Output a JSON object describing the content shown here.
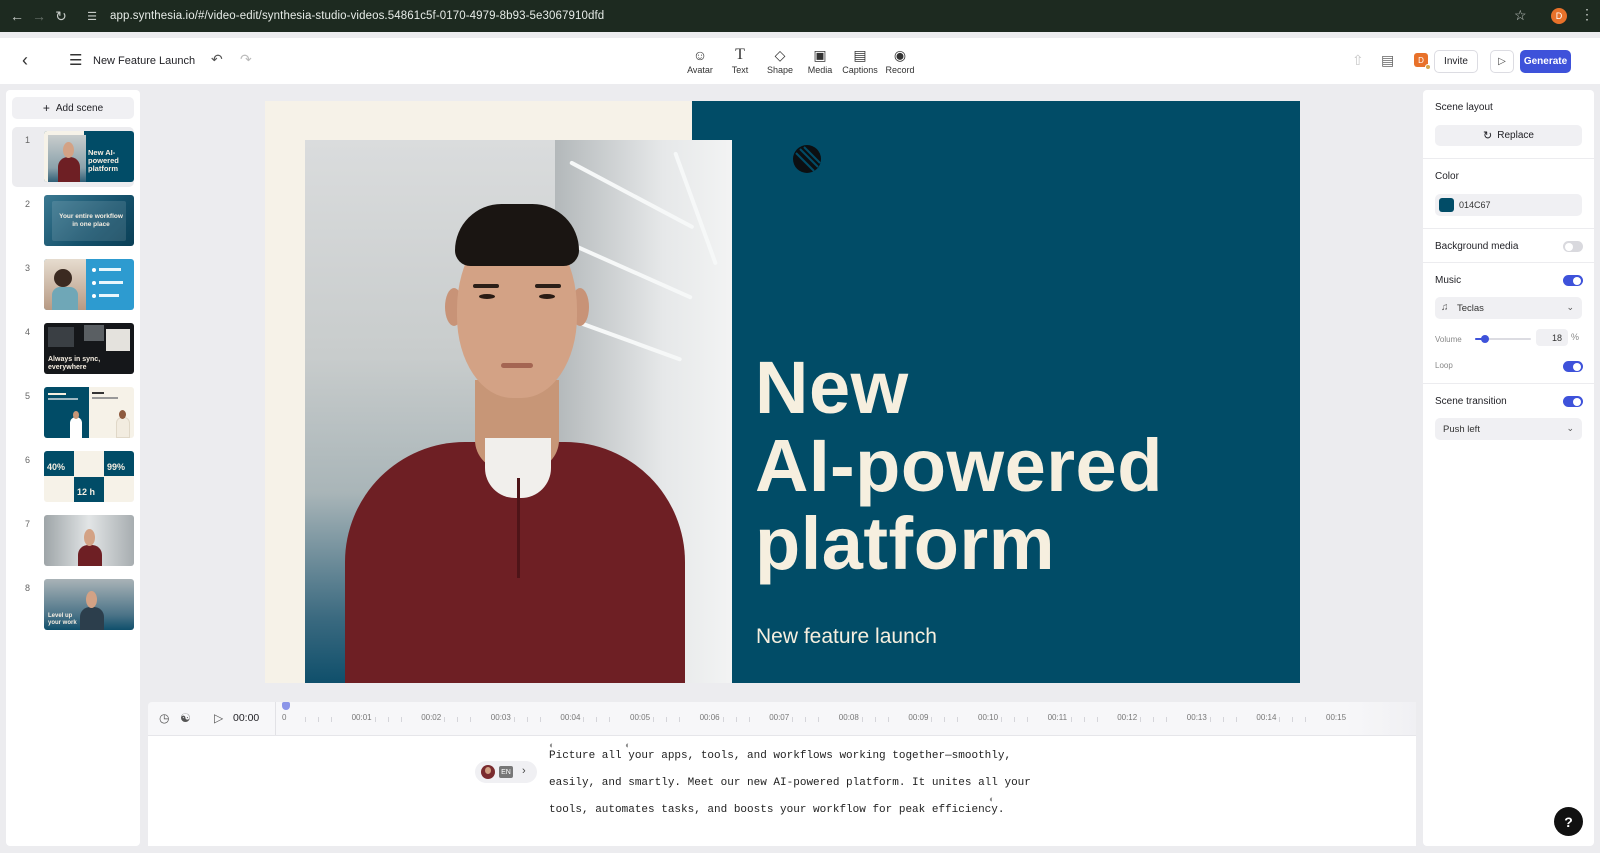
{
  "browser": {
    "url": "app.synthesia.io/#/video-edit/synthesia-studio-videos.54861c5f-0170-4979-8b93-5e3067910dfd",
    "profile_initial": "D"
  },
  "header": {
    "title": "New Feature Launch",
    "tools": [
      {
        "label": "Avatar",
        "icon": "avatar-icon"
      },
      {
        "label": "Text",
        "icon": "text-icon"
      },
      {
        "label": "Shape",
        "icon": "shape-icon"
      },
      {
        "label": "Media",
        "icon": "media-icon"
      },
      {
        "label": "Captions",
        "icon": "captions-icon"
      },
      {
        "label": "Record",
        "icon": "record-icon"
      }
    ],
    "user_initial": "D",
    "invite_label": "Invite",
    "generate_label": "Generate"
  },
  "scenes": {
    "add_label": "Add scene",
    "items": [
      {
        "number": "1",
        "caption": "New AI-powered platform"
      },
      {
        "number": "2",
        "caption": "Your entire workflow in one place"
      },
      {
        "number": "3",
        "caption": ""
      },
      {
        "number": "4",
        "caption": "Always in sync, everywhere"
      },
      {
        "number": "5",
        "caption": ""
      },
      {
        "number": "6",
        "caption": ""
      },
      {
        "number": "7",
        "caption": ""
      },
      {
        "number": "8",
        "caption": "Level up your work"
      }
    ],
    "scene6_stats": [
      "40%",
      "99%",
      "12 h"
    ]
  },
  "canvas": {
    "headline_1": "New",
    "headline_2": "AI-powered",
    "headline_3": "platform",
    "subtitle": "New feature launch",
    "background_color": "#014C67",
    "text_color": "#F6EFDF"
  },
  "timeline": {
    "current_time": "00:00",
    "ticks": [
      "0",
      "00:01",
      "00:02",
      "00:03",
      "00:04",
      "00:05",
      "00:06",
      "00:07",
      "00:08",
      "00:09",
      "00:10",
      "00:11",
      "00:12",
      "00:13",
      "00:14",
      "00:15"
    ]
  },
  "script": {
    "voice_language": "EN",
    "lines": [
      "Picture all your apps, tools, and workflows working together—smoothly,",
      "easily, and smartly. Meet our new AI-powered platform. It unites all your",
      "tools, automates tasks, and boosts your workflow for peak efficiency."
    ]
  },
  "properties": {
    "scene_layout_title": "Scene layout",
    "replace_label": "Replace",
    "color_title": "Color",
    "color_value": "014C67",
    "color_swatch": "#014C67",
    "background_media_label": "Background media",
    "background_media_on": false,
    "music_label": "Music",
    "music_on": true,
    "music_track": "Teclas",
    "volume_label": "Volume",
    "volume_value": "18",
    "volume_fraction": 0.18,
    "volume_unit": "%",
    "loop_label": "Loop",
    "loop_on": true,
    "transition_label": "Scene transition",
    "transition_on": true,
    "transition_value": "Push left"
  },
  "colors": {
    "accent": "#3E52DA",
    "brand_dark": "#014C67",
    "cream": "#F6F2E8"
  }
}
